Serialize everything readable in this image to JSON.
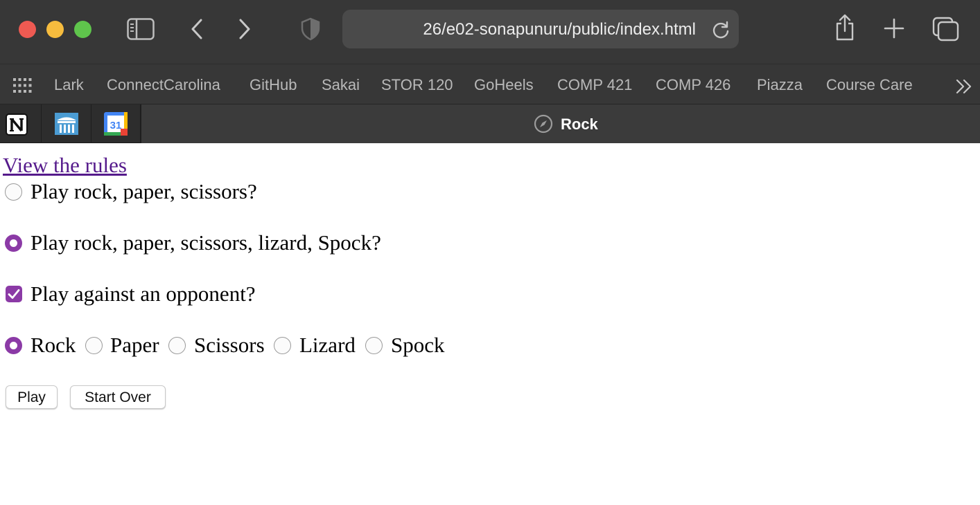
{
  "browser": {
    "url_text": "26/e02-sonapunuru/public/index.html",
    "favorites": [
      "Lark",
      "ConnectCarolina",
      "GitHub",
      "Sakai",
      "STOR 120",
      "GoHeels",
      "COMP 421",
      "COMP 426",
      "Piazza",
      "Course Care"
    ],
    "pinned_tabs": [
      "notion-icon",
      "unc-building-icon",
      "calendar-icon"
    ],
    "calendar_day": "31",
    "active_tab_title": "Rock",
    "colors": {
      "toolbar": "#373737",
      "tabbar": "#2d2d2d",
      "accent": "#8b3aa6"
    }
  },
  "page": {
    "rules_link": "View the rules",
    "mode_options": [
      {
        "label": "Play rock, paper, scissors?",
        "selected": false
      },
      {
        "label": "Play rock, paper, scissors, lizard, Spock?",
        "selected": true
      }
    ],
    "opponent_label": "Play against an opponent?",
    "opponent_checked": true,
    "moves": [
      {
        "label": "Rock",
        "selected": true
      },
      {
        "label": "Paper",
        "selected": false
      },
      {
        "label": "Scissors",
        "selected": false
      },
      {
        "label": "Lizard",
        "selected": false
      },
      {
        "label": "Spock",
        "selected": false
      }
    ],
    "play_button": "Play",
    "start_over_button": "Start Over"
  }
}
